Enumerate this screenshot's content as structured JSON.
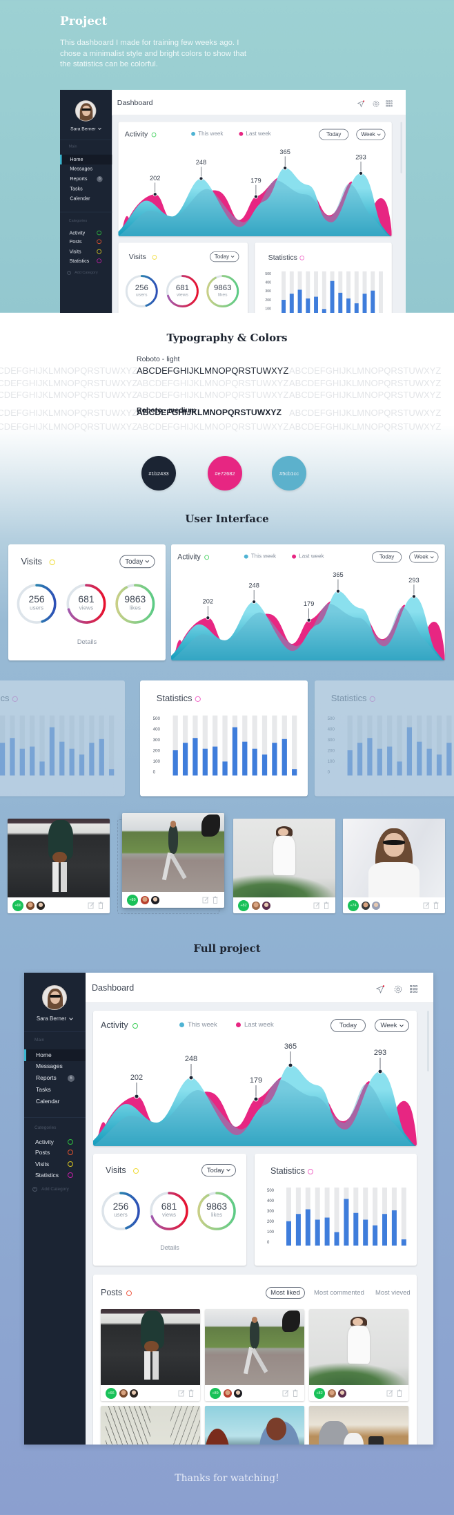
{
  "intro": {
    "title": "Project",
    "description": "This dashboard I made for training few weeks ago. I chose a minimalist style and bright colors to show that the statistics can be colorful."
  },
  "typography": {
    "title": "Typography & Colors",
    "light_label": "Roboto - light",
    "medium_label": "Roboto - medium",
    "alphabet": "ABCDEFGHIJKLMNOPQRSTUWXYZ"
  },
  "colors": [
    {
      "hex": "#1b2433",
      "label": "#1b2433"
    },
    {
      "hex": "#e72682",
      "label": "#e72682"
    },
    {
      "hex": "#5cb1cc",
      "label": "#5cb1cc"
    }
  ],
  "ui_section": {
    "title": "User Interface"
  },
  "full_section": {
    "title": "Full project"
  },
  "outro": "Thanks for watching!",
  "dashboard": {
    "user": {
      "name": "Sara Berner"
    },
    "nav": {
      "main_label": "Main",
      "items": [
        {
          "label": "Home",
          "active": true
        },
        {
          "label": "Messages"
        },
        {
          "label": "Reports",
          "badge": "6"
        },
        {
          "label": "Tasks"
        },
        {
          "label": "Calendar"
        }
      ]
    },
    "categories": {
      "label": "Categories",
      "items": [
        {
          "label": "Activity",
          "color": "#2fbf3f"
        },
        {
          "label": "Posts",
          "color": "#e0522e"
        },
        {
          "label": "Visits",
          "color": "#d8c421"
        },
        {
          "label": "Statistics",
          "color": "#c51fa8"
        }
      ],
      "add_label": "Add Category"
    },
    "header": {
      "title": "Dashboard",
      "icons": [
        "send-icon",
        "gear-icon",
        "grid-icon"
      ],
      "notification_color": "#e8203a"
    },
    "activity": {
      "title": "Activity",
      "status_color": "#3ecf5a",
      "legend": [
        {
          "label": "This week",
          "color": "#4fb3d3"
        },
        {
          "label": "Last week",
          "color": "#e72682"
        }
      ],
      "today_label": "Today",
      "week_label": "Week",
      "peaks": [
        202,
        248,
        179,
        365,
        293
      ]
    },
    "visits": {
      "title": "Visits",
      "status_color": "#f0dc3a",
      "filter": "Today",
      "rings": [
        {
          "value": "256",
          "label": "users",
          "fraction": 0.45,
          "colors": [
            "#2ab7a9",
            "#2d4fb6"
          ]
        },
        {
          "value": "681",
          "label": "views",
          "fraction": 0.7,
          "colors": [
            "#a05bb0",
            "#e8112d"
          ]
        },
        {
          "value": "9863",
          "label": "likes",
          "fraction": 0.92,
          "colors": [
            "#c9cf86",
            "#5ccb85"
          ]
        }
      ],
      "details": "Details"
    },
    "statistics": {
      "status_color": "#f06ac8"
    },
    "posts": {
      "title": "Posts",
      "status_color": "#f0604a",
      "tabs": [
        "Most liked",
        "Most commented",
        "Most vieved"
      ],
      "items": [
        {
          "likes": "+66"
        },
        {
          "likes": "+89"
        },
        {
          "likes": "+82"
        },
        {
          "likes": ""
        },
        {
          "likes": ""
        },
        {
          "likes": ""
        }
      ]
    }
  },
  "ui_posts": [
    {
      "likes": "+66"
    },
    {
      "likes": "+89"
    },
    {
      "likes": "+82"
    },
    {
      "likes": "+74"
    }
  ],
  "chart_data": {
    "type": "bar",
    "title": "Statistics",
    "ytick_labels": [
      "500",
      "400",
      "300",
      "200",
      "100",
      "0"
    ],
    "ylim": [
      0,
      500
    ],
    "values": [
      235,
      305,
      350,
      250,
      270,
      130,
      450,
      315,
      250,
      195,
      305,
      340,
      60
    ],
    "grid": false,
    "colors": {
      "bar": "#3f7ddb",
      "track": "#e8e9eb"
    }
  }
}
